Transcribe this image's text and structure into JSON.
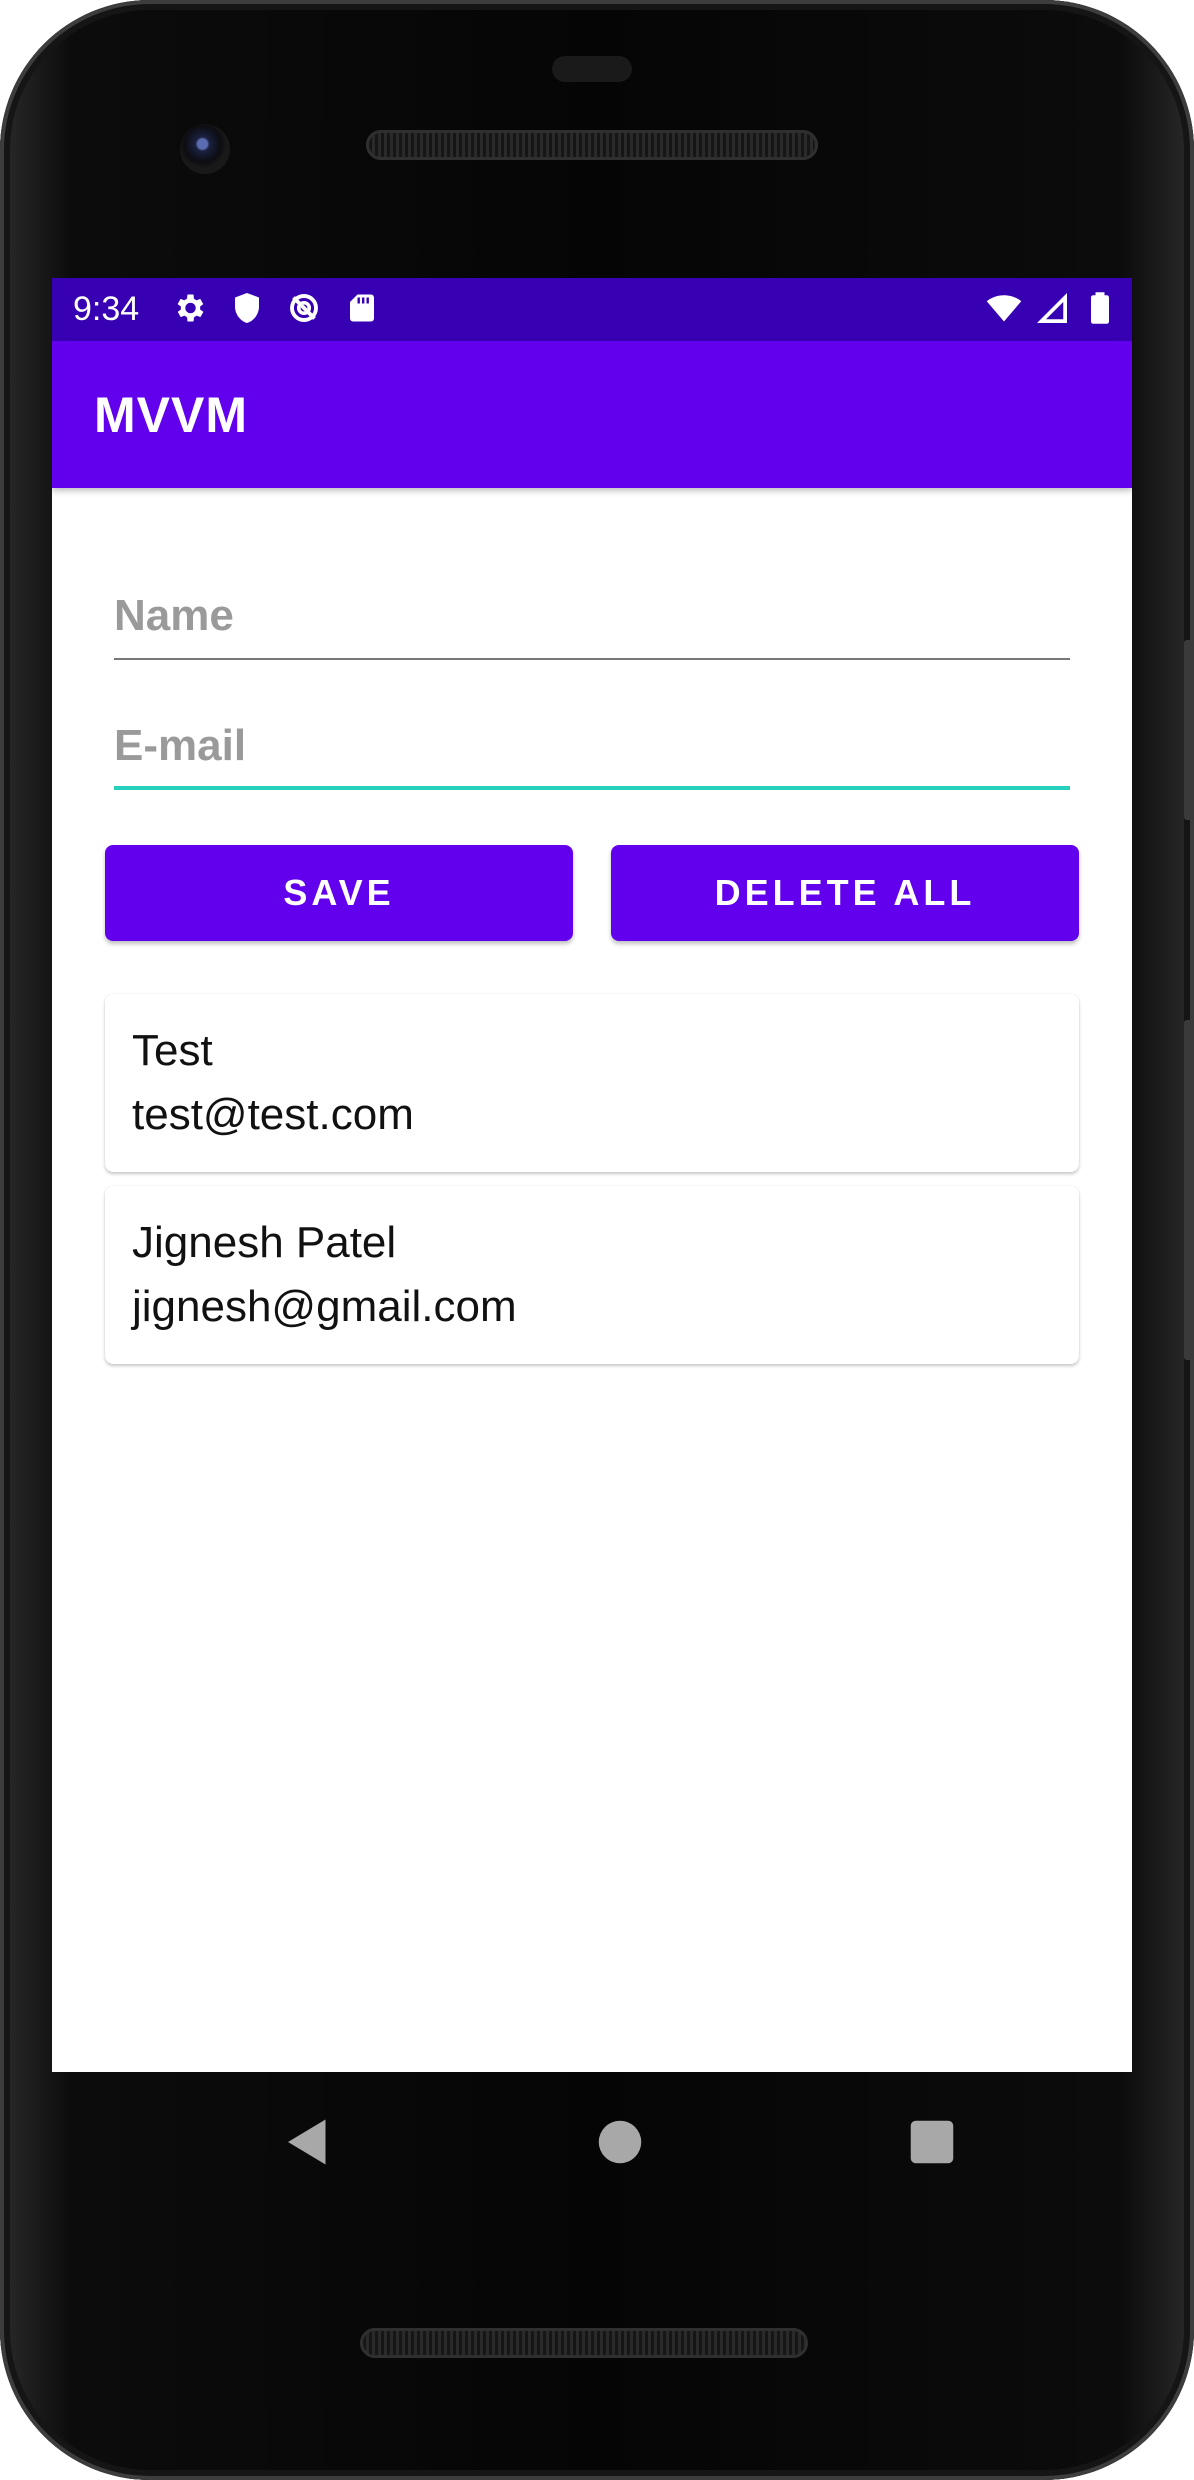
{
  "status_bar": {
    "time": "9:34",
    "left_icons": [
      "gear-icon",
      "shield-icon",
      "sync-disabled-icon",
      "sd-card-icon"
    ],
    "right_icons": [
      "wifi-icon",
      "cell-signal-icon",
      "battery-icon"
    ]
  },
  "app_bar": {
    "title": "MVVM"
  },
  "form": {
    "name_placeholder": "Name",
    "name_value": "",
    "email_placeholder": "E-mail",
    "email_value": ""
  },
  "buttons": {
    "save_label": "SAVE",
    "delete_all_label": "DELETE ALL"
  },
  "subscribers": [
    {
      "name": "Test",
      "email": "test@test.com"
    },
    {
      "name": "Jignesh Patel",
      "email": "jignesh@gmail.com"
    }
  ],
  "nav_bar": {
    "back": "back-icon",
    "home": "home-icon",
    "recents": "recents-icon"
  },
  "colors": {
    "status_bar": "#3700b3",
    "primary": "#6200ee",
    "focus_underline": "#26d0bd"
  }
}
